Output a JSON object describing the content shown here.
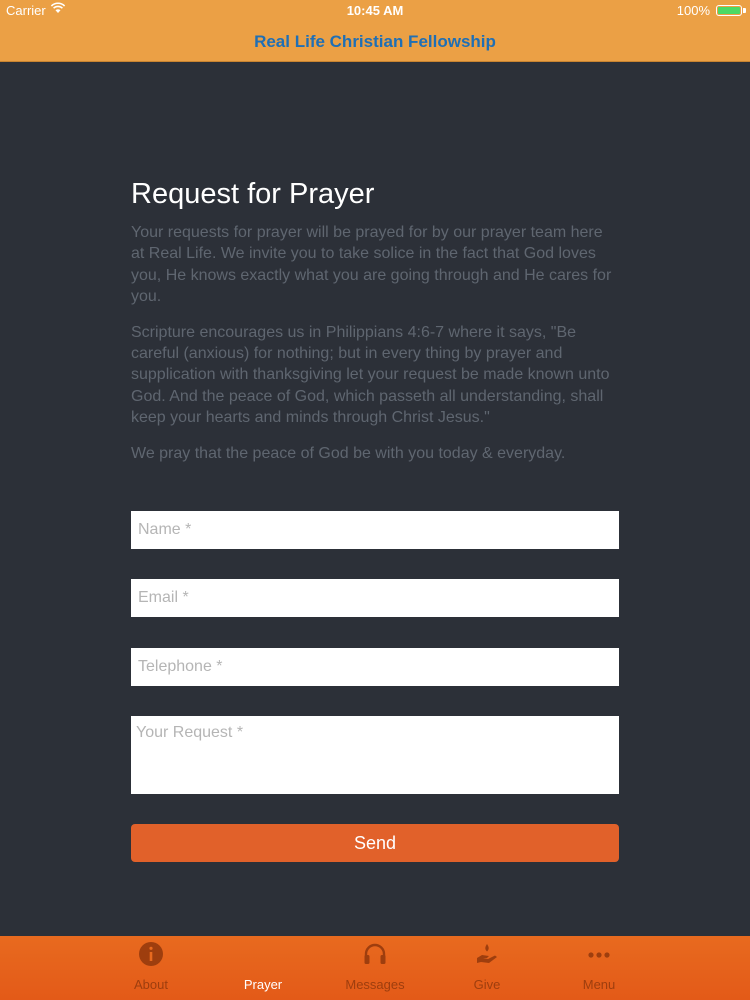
{
  "status_bar": {
    "carrier": "Carrier",
    "time": "10:45 AM",
    "battery": "100%",
    "battery_level": 1.0
  },
  "nav": {
    "title": "Real Life Christian Fellowship"
  },
  "page": {
    "heading": "Request for Prayer",
    "paragraphs": [
      "Your requests for prayer will be prayed for by our prayer team here at Real Life. We invite you to take solice in the fact that God loves you, He knows exactly what you are going through and He cares for you.",
      "Scripture encourages us in Philippians 4:6-7 where it says, \"Be careful (anxious) for nothing; but in every thing by prayer and supplication with thanksgiving let your request be made known unto God. And the peace of God, which passeth all understanding, shall keep your hearts and minds through Christ Jesus.\"",
      "We pray that the peace of God be with you today & everyday."
    ]
  },
  "form": {
    "name": {
      "value": "",
      "placeholder": "Name *"
    },
    "email": {
      "value": "",
      "placeholder": "Email *"
    },
    "telephone": {
      "value": "",
      "placeholder": "Telephone *"
    },
    "request": {
      "value": "",
      "placeholder": "Your Request *"
    },
    "send_label": "Send"
  },
  "tabbar": {
    "items": [
      {
        "label": "About",
        "icon": "info-icon",
        "active": false
      },
      {
        "label": "Prayer",
        "icon": "praying-hands-icon",
        "active": true
      },
      {
        "label": "Messages",
        "icon": "headphones-icon",
        "active": false
      },
      {
        "label": "Give",
        "icon": "hand-heart-icon",
        "active": false
      },
      {
        "label": "Menu",
        "icon": "more-dots-icon",
        "active": false
      }
    ]
  },
  "colors": {
    "header": "#eba045",
    "title": "#1f6fb5",
    "background": "#2c3038",
    "accent": "#e1612a",
    "tab_inactive": "#9e3e0e",
    "tab_active": "#ffffff"
  }
}
